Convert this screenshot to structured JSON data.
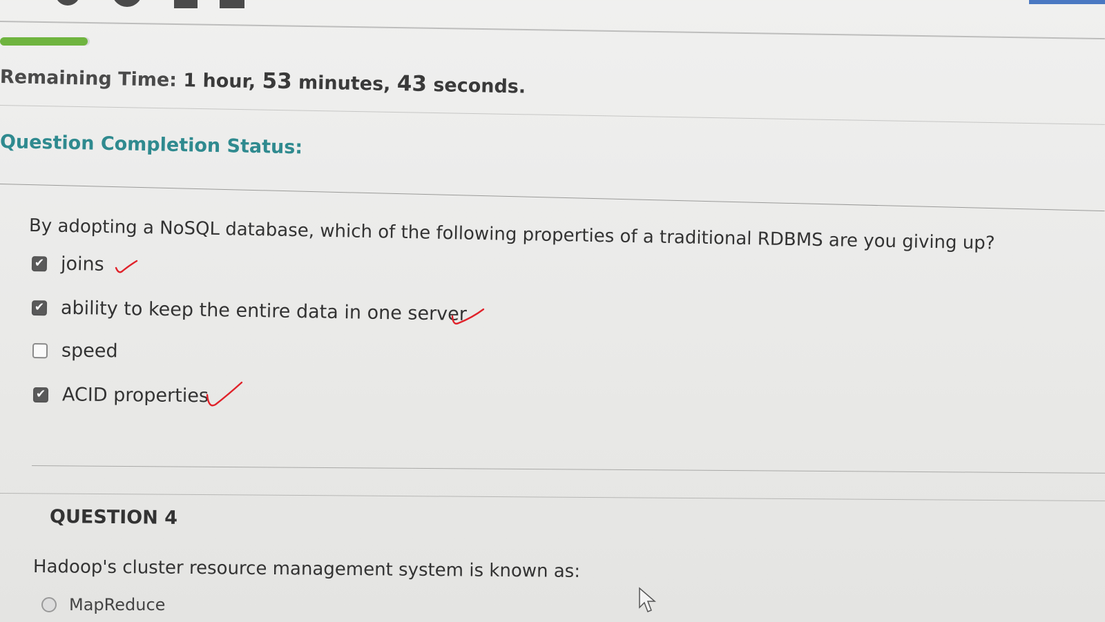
{
  "progress": {
    "percent": 8
  },
  "timer": {
    "label": "Remaining Time:",
    "value_prefix": "1 hour, ",
    "minutes": "53",
    "minutes_unit": " minutes, ",
    "seconds": "43",
    "seconds_unit": " seconds."
  },
  "status": {
    "label": "Question Completion Status:"
  },
  "question3": {
    "text": "By adopting a NoSQL database, which of the following properties of a traditional RDBMS are you giving up?",
    "options": [
      {
        "label": "joins",
        "checked": true
      },
      {
        "label": "ability to keep the entire data in one server",
        "checked": true
      },
      {
        "label": "speed",
        "checked": false
      },
      {
        "label": "ACID properties",
        "checked": true
      }
    ]
  },
  "question4": {
    "heading": "QUESTION 4",
    "text": "Hadoop's cluster resource management system is known as:",
    "options": [
      {
        "label": "MapReduce"
      }
    ]
  },
  "colors": {
    "accent_teal": "#2f8a8f",
    "progress_green": "#6fb43f",
    "handwritten_red": "#e0222a"
  }
}
